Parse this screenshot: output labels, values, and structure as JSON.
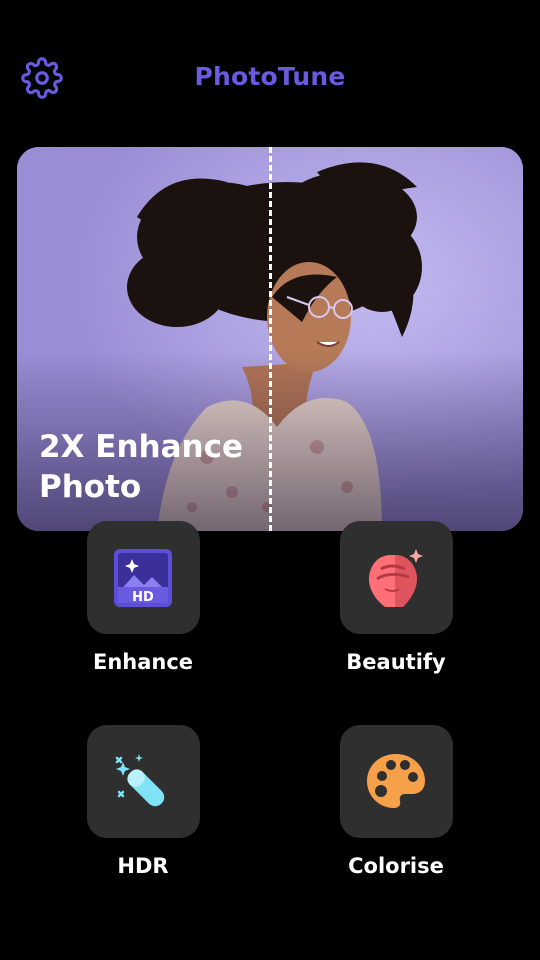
{
  "header": {
    "title": "PhotoTune",
    "settings_icon": "gear-icon",
    "accent_color": "#6a5ae0"
  },
  "hero": {
    "title": "2X Enhance Photo",
    "title_line1": "2X Enhance",
    "title_line2": "Photo",
    "background_color": "#a89ce0"
  },
  "features": [
    {
      "label": "Enhance",
      "icon": "hd-image-icon"
    },
    {
      "label": "Beautify",
      "icon": "face-sparkle-icon"
    },
    {
      "label": "HDR",
      "icon": "magic-wand-icon"
    },
    {
      "label": "Colorise",
      "icon": "palette-icon"
    }
  ]
}
